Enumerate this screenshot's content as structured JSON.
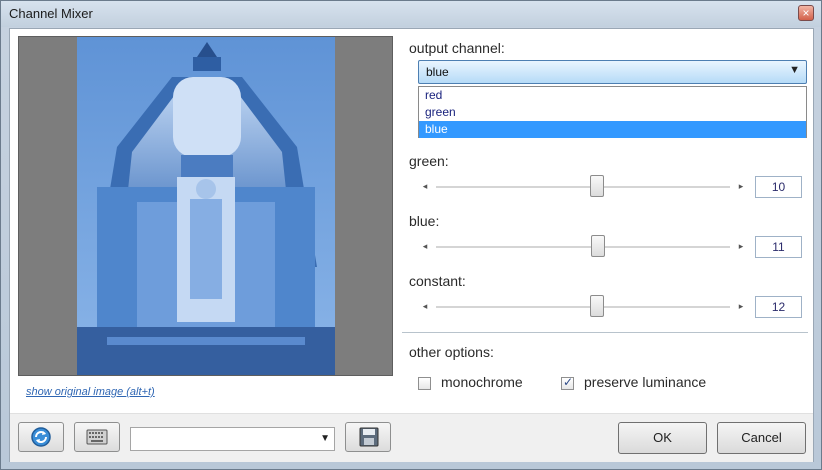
{
  "window": {
    "title": "Channel Mixer",
    "close_glyph": "×"
  },
  "preview": {
    "link_text": "show original image (alt+t)"
  },
  "output_channel": {
    "label": "output channel:",
    "selected": "blue",
    "options": [
      "red",
      "green",
      "blue"
    ],
    "arrow": "▼"
  },
  "sliders": [
    {
      "label": "green:",
      "value": "10",
      "left_arrow": "◂",
      "right_arrow": "▸"
    },
    {
      "label": "blue:",
      "value": "11",
      "left_arrow": "◂",
      "right_arrow": "▸"
    },
    {
      "label": "constant:",
      "value": "12",
      "left_arrow": "◂",
      "right_arrow": "▸"
    }
  ],
  "other_options": {
    "label": "other options:",
    "monochrome": {
      "label": "monochrome",
      "checked": false
    },
    "preserve_luminance": {
      "label": "preserve luminance",
      "checked": true
    }
  },
  "bottom": {
    "preset_combo_value": "",
    "combo_arrow": "▼",
    "ok_label": "OK",
    "cancel_label": "Cancel"
  },
  "colors": {
    "accent": "#3399ff",
    "photo_blue": "#3e78c4"
  }
}
